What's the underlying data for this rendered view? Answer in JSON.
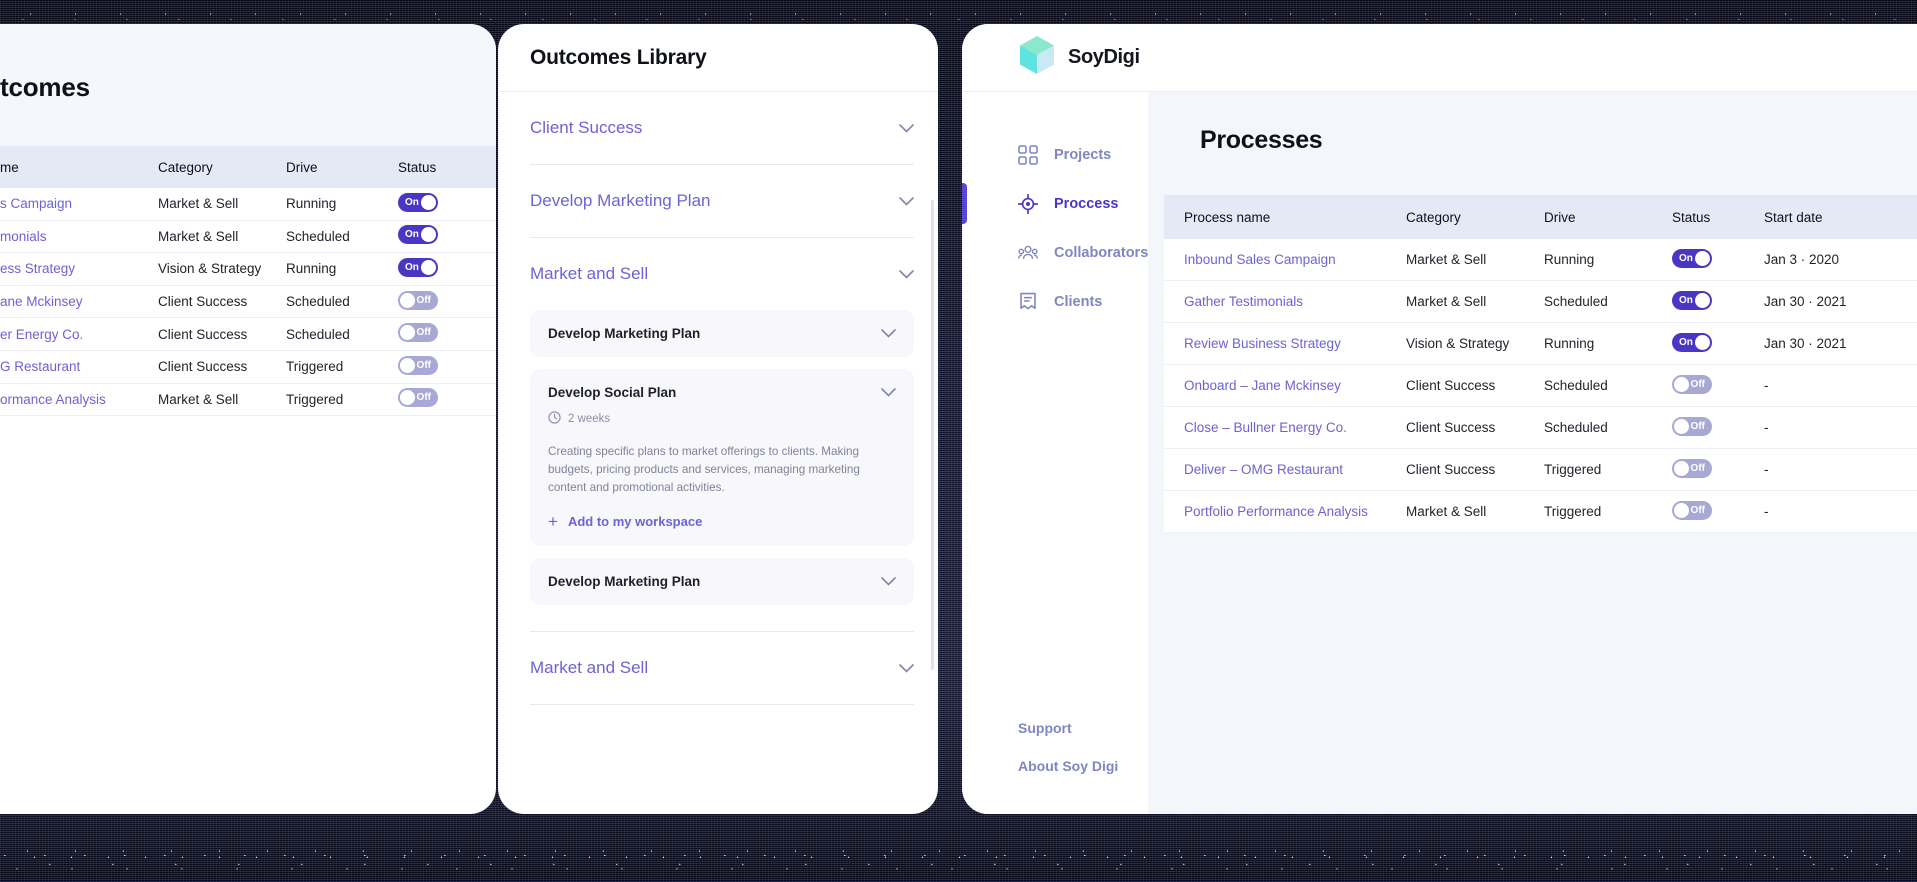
{
  "brand": {
    "name": "SoyDigi",
    "logo_icon": "cube-logo-icon"
  },
  "left_panel": {
    "title": "tcomes",
    "columns": [
      "me",
      "Category",
      "Drive",
      "Status"
    ],
    "rows": [
      {
        "name": "s Campaign",
        "category": "Market & Sell",
        "drive": "Running",
        "status": "On",
        "status_on": true
      },
      {
        "name": "monials",
        "category": "Market & Sell",
        "drive": "Scheduled",
        "status": "On",
        "status_on": true
      },
      {
        "name": "ess Strategy",
        "category": "Vision & Strategy",
        "drive": "Running",
        "status": "On",
        "status_on": true
      },
      {
        "name": "ane Mckinsey",
        "category": "Client Success",
        "drive": "Scheduled",
        "status": "Off",
        "status_on": false
      },
      {
        "name": "er Energy Co.",
        "category": "Client Success",
        "drive": "Scheduled",
        "status": "Off",
        "status_on": false
      },
      {
        "name": "G Restaurant",
        "category": "Client Success",
        "drive": "Triggered",
        "status": "Off",
        "status_on": false
      },
      {
        "name": "ormance Analysis",
        "category": "Market & Sell",
        "drive": "Triggered",
        "status": "Off",
        "status_on": false
      }
    ]
  },
  "middle_panel": {
    "title": "Outcomes Library",
    "groups": [
      {
        "label": "Client Success",
        "expanded": false
      },
      {
        "label": "Develop Marketing Plan",
        "expanded": false
      },
      {
        "label": "Market and Sell",
        "expanded": true
      },
      {
        "label": "Market and Sell",
        "expanded": false
      }
    ],
    "cards": [
      {
        "title": "Develop Marketing Plan",
        "expanded": false
      },
      {
        "title": "Develop Social Plan",
        "expanded": true,
        "duration": "2 weeks",
        "duration_icon": "clock-icon",
        "description": "Creating specific plans to market offerings to clients. Making budgets, pricing products and services, managing marketing content and promotional activities.",
        "add_label": "Add to my workspace",
        "add_icon": "plus-icon"
      },
      {
        "title": "Develop Marketing Plan",
        "expanded": false
      }
    ],
    "chevron_icon": "chevron-down-icon"
  },
  "right_panel": {
    "nav": [
      {
        "label": "Projects",
        "icon": "grid-icon",
        "active": false
      },
      {
        "label": "Proccess",
        "icon": "target-icon",
        "active": true
      },
      {
        "label": "Collaborators",
        "icon": "people-icon",
        "active": false
      },
      {
        "label": "Clients",
        "icon": "bookmark-icon",
        "active": false
      }
    ],
    "footer_links": [
      "Support",
      "About Soy Digi"
    ],
    "page_title": "Processes",
    "table": {
      "columns": [
        "Process name",
        "Category",
        "Drive",
        "Status",
        "Start date"
      ],
      "rows": [
        {
          "name": "Inbound Sales Campaign",
          "category": "Market & Sell",
          "drive": "Running",
          "status": "On",
          "status_on": true,
          "start_date": "Jan 3 · 2020"
        },
        {
          "name": "Gather Testimonials",
          "category": "Market & Sell",
          "drive": "Scheduled",
          "status": "On",
          "status_on": true,
          "start_date": "Jan 30 · 2021"
        },
        {
          "name": "Review Business Strategy",
          "category": "Vision & Strategy",
          "drive": "Running",
          "status": "On",
          "status_on": true,
          "start_date": "Jan 30 · 2021"
        },
        {
          "name": "Onboard – Jane Mckinsey",
          "category": "Client Success",
          "drive": "Scheduled",
          "status": "Off",
          "status_on": false,
          "start_date": "-"
        },
        {
          "name": "Close – Bullner Energy Co.",
          "category": "Client Success",
          "drive": "Scheduled",
          "status": "Off",
          "status_on": false,
          "start_date": "-"
        },
        {
          "name": "Deliver – OMG Restaurant",
          "category": "Client Success",
          "drive": "Triggered",
          "status": "Off",
          "status_on": false,
          "start_date": "-"
        },
        {
          "name": "Portfolio Performance Analysis",
          "category": "Market & Sell",
          "drive": "Triggered",
          "status": "Off",
          "status_on": false,
          "start_date": "-"
        }
      ]
    }
  },
  "colors": {
    "accent": "#4a36c4",
    "link": "#6c63d6",
    "nav_idle": "#7f86c4",
    "table_header_bg": "#e4eaf5",
    "content_bg": "#f3f7fb",
    "card_bg": "#f7f7fc",
    "toggle_off_bg": "#a7a9d4"
  }
}
